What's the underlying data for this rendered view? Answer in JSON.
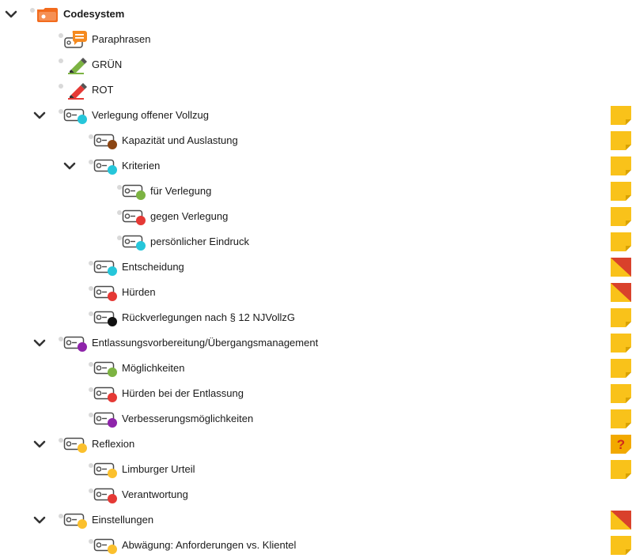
{
  "code_system": {
    "items": [
      {
        "label": "Codesystem",
        "level": 0,
        "expand": true,
        "icon": "codesystem-folder-icon",
        "bold": true,
        "memo": ""
      },
      {
        "label": "Paraphrasen",
        "level": 1,
        "expand": false,
        "icon": "paraphrase-speech-bubble-icon",
        "memo": ""
      },
      {
        "label": "GRÜN",
        "level": 1,
        "expand": false,
        "icon": "green-highlighter-icon",
        "color": "#7cb342",
        "memo": ""
      },
      {
        "label": "ROT",
        "level": 1,
        "expand": false,
        "icon": "red-highlighter-icon",
        "color": "#e53935",
        "memo": ""
      },
      {
        "label": "Verlegung offener Vollzug",
        "level": 1,
        "expand": true,
        "icon": "code-tag-icon",
        "color": "#26c6da",
        "memo": "yellow"
      },
      {
        "label": "Kapazität und Auslastung",
        "level": 2,
        "expand": false,
        "icon": "code-tag-icon",
        "color": "#8b4513",
        "memo": "yellow"
      },
      {
        "label": "Kriterien",
        "level": 2,
        "expand": true,
        "icon": "code-tag-icon",
        "color": "#26c6da",
        "memo": "yellow"
      },
      {
        "label": "für Verlegung",
        "level": 3,
        "expand": false,
        "icon": "code-tag-icon",
        "color": "#7cb342",
        "memo": "yellow"
      },
      {
        "label": "gegen Verlegung",
        "level": 3,
        "expand": false,
        "icon": "code-tag-icon",
        "color": "#e53935",
        "memo": "yellow"
      },
      {
        "label": "persönlicher Eindruck",
        "level": 3,
        "expand": false,
        "icon": "code-tag-icon",
        "color": "#26c6da",
        "memo": "yellow"
      },
      {
        "label": "Entscheidung",
        "level": 2,
        "expand": false,
        "icon": "code-tag-icon",
        "color": "#26c6da",
        "memo": "red-yellow"
      },
      {
        "label": "Hürden",
        "level": 2,
        "expand": false,
        "icon": "code-tag-icon",
        "color": "#e53935",
        "memo": "red-yellow"
      },
      {
        "label": "Rückverlegungen nach § 12 NJVollzG",
        "level": 2,
        "expand": false,
        "icon": "code-tag-icon",
        "color": "#111111",
        "memo": "yellow"
      },
      {
        "label": "Entlassungsvorbereitung/Übergangsmanagement",
        "level": 1,
        "expand": true,
        "icon": "code-tag-icon",
        "color": "#8e24aa",
        "memo": "yellow"
      },
      {
        "label": "Möglichkeiten",
        "level": 2,
        "expand": false,
        "icon": "code-tag-icon",
        "color": "#7cb342",
        "memo": "yellow"
      },
      {
        "label": "Hürden bei der Entlassung",
        "level": 2,
        "expand": false,
        "icon": "code-tag-icon",
        "color": "#e53935",
        "memo": "yellow"
      },
      {
        "label": "Verbesserungsmöglichkeiten",
        "level": 2,
        "expand": false,
        "icon": "code-tag-icon",
        "color": "#8e24aa",
        "memo": "yellow"
      },
      {
        "label": "Reflexion",
        "level": 1,
        "expand": true,
        "icon": "code-tag-icon",
        "color": "#fbc02d",
        "memo": "question"
      },
      {
        "label": "Limburger Urteil",
        "level": 2,
        "expand": false,
        "icon": "code-tag-icon",
        "color": "#fbc02d",
        "memo": "yellow"
      },
      {
        "label": "Verantwortung",
        "level": 2,
        "expand": false,
        "icon": "code-tag-icon",
        "color": "#e53935",
        "memo": ""
      },
      {
        "label": "Einstellungen",
        "level": 1,
        "expand": true,
        "icon": "code-tag-icon",
        "color": "#fbc02d",
        "memo": "red-yellow"
      },
      {
        "label": "Abwägung: Anforderungen vs. Klientel",
        "level": 2,
        "expand": false,
        "icon": "code-tag-icon",
        "color": "#fbc02d",
        "memo": "yellow"
      }
    ]
  },
  "memo_icons": {
    "question_mark": "?",
    "colors": {
      "yellow": "#f9c21a",
      "red": "#d9412b",
      "question": "#f2a900"
    }
  },
  "icons": {
    "outline": "#4a4a4a",
    "folder": "#f26b1d",
    "chevron": "#333333"
  }
}
